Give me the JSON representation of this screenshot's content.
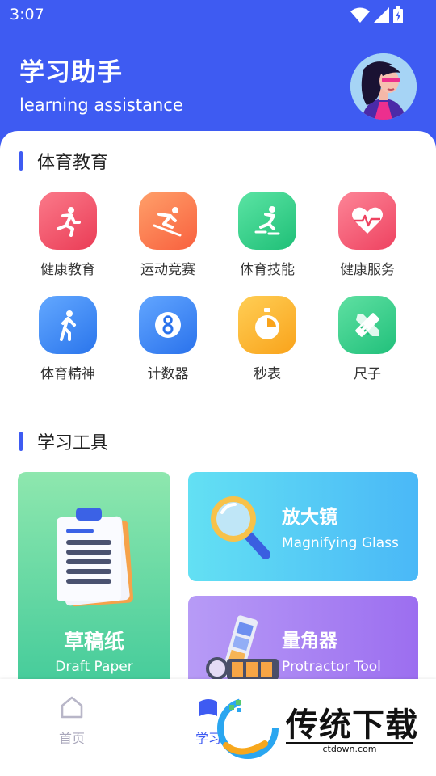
{
  "status": {
    "time": "3:07"
  },
  "header": {
    "title": "学习助手",
    "subtitle": "learning assistance"
  },
  "sections": {
    "sports": {
      "title": "体育教育",
      "items": [
        {
          "label": "健康教育",
          "icon": "running-icon",
          "color": "#f0546a"
        },
        {
          "label": "运动竞赛",
          "icon": "skiing-icon",
          "color": "#fd7848"
        },
        {
          "label": "体育技能",
          "icon": "skating-icon",
          "color": "#2fcf8a"
        },
        {
          "label": "健康服务",
          "icon": "heart-pulse-icon",
          "color": "#f5566e"
        },
        {
          "label": "体育精神",
          "icon": "walking-icon",
          "color": "#3d8bf5"
        },
        {
          "label": "计数器",
          "icon": "counter-8-icon",
          "color": "#3a83f6"
        },
        {
          "label": "秒表",
          "icon": "stopwatch-icon",
          "color": "#fbb02c"
        },
        {
          "label": "尺子",
          "icon": "ruler-pencil-icon",
          "color": "#31cd86"
        }
      ]
    },
    "tools": {
      "title": "学习工具",
      "cards": [
        {
          "title": "草稿纸",
          "subtitle": "Draft Paper",
          "icon": "clipboard-icon"
        },
        {
          "title": "放大镜",
          "subtitle": "Magnifying Glass",
          "icon": "magnifier-icon"
        },
        {
          "title": "量角器",
          "subtitle": "Protractor Tool",
          "icon": "color-swatch-icon"
        }
      ]
    }
  },
  "nav": {
    "home": {
      "label": "首页",
      "icon": "home-icon"
    },
    "study": {
      "label": "学习",
      "icon": "study-icon"
    }
  },
  "watermark": {
    "brand": "传统下载",
    "domain": "ctdown.com"
  }
}
